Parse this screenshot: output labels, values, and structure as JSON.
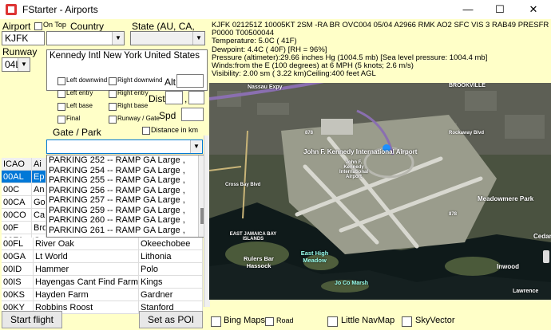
{
  "window": {
    "title": "FStarter - Airports",
    "minimize": "—",
    "maximize": "☐",
    "close": "✕"
  },
  "left": {
    "airport_label": "Airport",
    "airport_value": "KJFK",
    "on_top_label": "On Top",
    "country_label": "Country",
    "state_label": "State (AU, CA, US)",
    "runway_label": "Runway",
    "runway_value": "04L",
    "airport_name": "Kennedy Intl New York  United States",
    "checks": [
      {
        "label": "Left downwind"
      },
      {
        "label": "Right downwind"
      },
      {
        "label": "Left entry"
      },
      {
        "label": "Right entry"
      },
      {
        "label": "Left base"
      },
      {
        "label": "Right base"
      },
      {
        "label": "Final"
      },
      {
        "label": "Runway / Gate"
      }
    ],
    "alt_label": "Alt",
    "dist_label": "Dist",
    "dist_sep": ",",
    "spd_label": "Spd",
    "distance_km_label": "Distance in km",
    "gate_label": "Gate / Park",
    "parking": [
      "PARKING 252  --  RAMP GA Large  ,",
      "PARKING 254  --  RAMP GA Large  ,",
      "PARKING 255  --  RAMP GA Large  ,",
      "PARKING 256  --  RAMP GA Large  ,",
      "PARKING 257  --  RAMP GA Large  ,",
      "PARKING 259  --  RAMP GA Large  ,",
      "PARKING 260  --  RAMP GA Large  ,",
      "PARKING 261  --  RAMP GA Large  ,"
    ],
    "table_header": [
      "ICAO",
      "Ai"
    ],
    "table_rows_top": [
      [
        "00AL",
        "Ep"
      ],
      [
        "00C",
        "An"
      ],
      [
        "00CA",
        "Go"
      ],
      [
        "00CO",
        "Ca"
      ],
      [
        "00F",
        "Bro"
      ],
      [
        "00FA",
        "Gr"
      ]
    ],
    "table_rows": [
      [
        "00FL",
        "River Oak",
        "Okeechobee"
      ],
      [
        "00GA",
        "Lt World",
        "Lithonia"
      ],
      [
        "00ID",
        "Hammer",
        "Polo"
      ],
      [
        "00IS",
        "Hayengas Cant Find Farms",
        "Kings"
      ],
      [
        "00KS",
        "Hayden Farm",
        "Gardner"
      ],
      [
        "00KY",
        "Robbins Roost",
        "Stanford"
      ]
    ],
    "start_flight": "Start flight",
    "set_as_poi": "Set as POI"
  },
  "metar": {
    "lines": [
      "KJFK 021251Z 10005KT 2SM -RA BR OVC004 05/04 A2966 RMK AO2 SFC VIS 3 RAB49 PRESFR SLP044",
      "P0000 T00500044",
      "Temperature:  5.0C ( 41F)",
      "Dewpoint:  4.4C ( 40F) [RH =  96%]",
      "Pressure (altimeter):29.66 inches Hg (1004.5 mb) [Sea level pressure: 1004.4 mb]",
      "Winds:from the E (100 degrees) at  6 MPH (5 knots;  2.6 m/s)",
      "Visibility: 2.00 sm ( 3.22 km)Ceiling:400 feet AGL"
    ]
  },
  "map": {
    "labels": {
      "nassau": "Nassau Expy",
      "brookville": "BROOKVILLE",
      "jfk_big": "John F. Kennedy International Airport",
      "jfk_small": "John F. Kennedy International Airport",
      "meadowmere": "Meadowmere Park",
      "east_jamaica": "EAST JAMAICA BAY ISLANDS",
      "rulers": "Rulers Bar Hassock",
      "east_high": "East High Meadow",
      "jo_co": "Jo Co Marsh",
      "inwood": "Inwood",
      "cedar": "Cedar",
      "lawrence": "Lawrence",
      "cross_bay": "Cross Bay Blvd",
      "rockaway": "Rockaway Blvd",
      "r878": "878",
      "r878b": "878"
    }
  },
  "bottom": {
    "options": [
      {
        "label": "Bing Maps"
      },
      {
        "label": "Road"
      },
      {
        "label": "Little NavMap"
      },
      {
        "label": "SkyVector"
      }
    ]
  },
  "colors": {
    "panel_bg": "#ffffc8",
    "selection": "#0078d7",
    "airport_blue": "#1e90ff"
  }
}
